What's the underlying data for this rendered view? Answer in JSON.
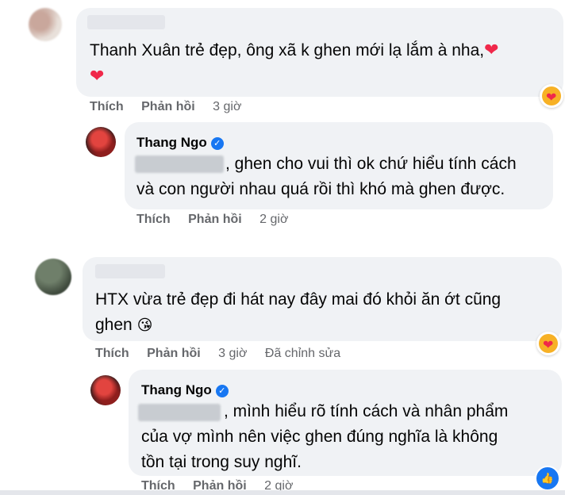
{
  "comments": [
    {
      "text_main": "Thanh Xuân trẻ đẹp, ông xã k ghen mới lạ lắm à nha,",
      "emoji_1": "❤",
      "emoji_2": "❤",
      "actions": {
        "like": "Thích",
        "reply": "Phản hồi",
        "time": "3 giờ"
      },
      "reply": {
        "name": "Thang Ngo",
        "verified_glyph": "✓",
        "line1": ", ghen cho vui thì ok chứ hiểu tính cách",
        "line2": "và con người nhau quá rồi thì khó mà ghen được.",
        "actions": {
          "like": "Thích",
          "reply": "Phản hồi",
          "time": "2 giờ"
        }
      }
    },
    {
      "line1": "HTX vừa trẻ đẹp đi hát nay đây mai đó khỏi ăn ớt cũng",
      "line2": "ghen",
      "emoji": "😘",
      "actions": {
        "like": "Thích",
        "reply": "Phản hồi",
        "time": "3 giờ",
        "edited": "Đã chỉnh sửa"
      },
      "reply": {
        "name": "Thang Ngo",
        "verified_glyph": "✓",
        "line1": ", mình hiểu rõ tính cách và nhân phẩm",
        "line2": "của vợ mình nên việc ghen đúng nghĩa là không",
        "line3": "tồn tại trong suy nghĩ.",
        "actions": {
          "like": "Thích",
          "reply": "Phản hồi",
          "time": "2 giờ"
        },
        "like_glyph": "👍"
      }
    }
  ],
  "colors": {
    "bubble": "#f0f2f5",
    "meta_text": "#65676b",
    "verified": "#1877f2",
    "heart": "#f0284a"
  },
  "icons": [
    "verified-badge-icon",
    "care-reaction-icon",
    "like-reaction-icon",
    "heart-emoji-icon",
    "kiss-emoji-icon"
  ]
}
